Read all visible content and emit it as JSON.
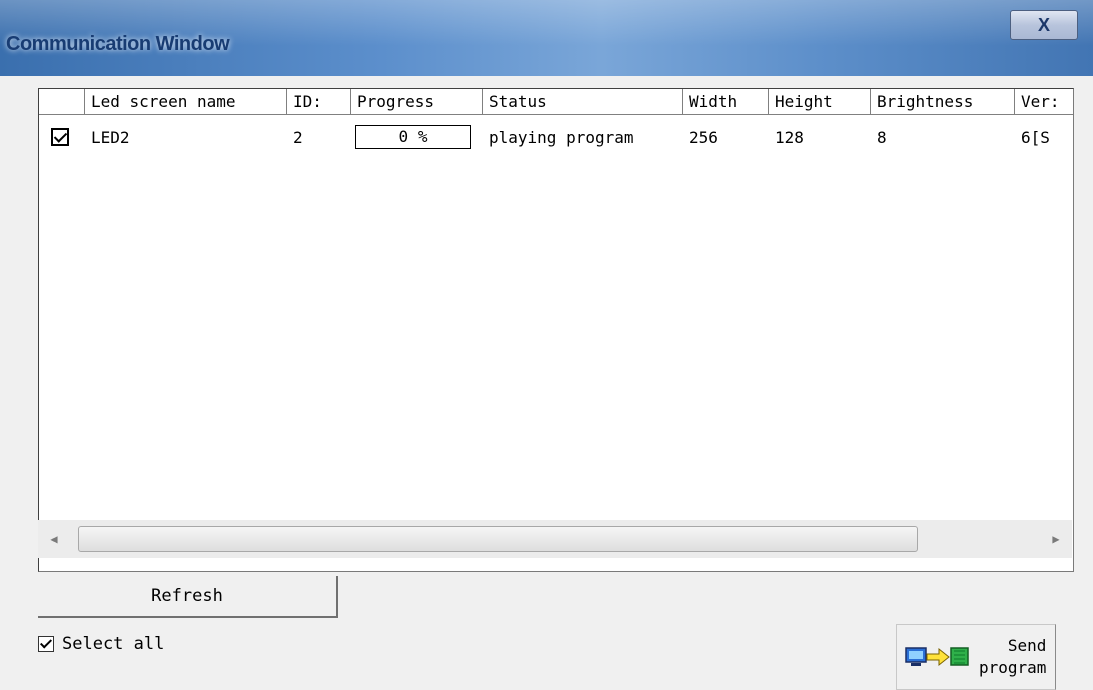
{
  "window": {
    "title": "Communication Window",
    "close_label": "X"
  },
  "table": {
    "columns": [
      "Led screen name",
      "ID:",
      "Progress",
      "Status",
      "Width",
      "Height",
      "Brightness",
      "Ver:"
    ],
    "rows": [
      {
        "checked": true,
        "name": "LED2",
        "id": "2",
        "progress": "0 %",
        "status": "playing program",
        "width": "256",
        "height": "128",
        "brightness": "8",
        "version": "6[S"
      }
    ]
  },
  "scrollbar": {
    "left_arrow": "◀",
    "right_arrow": "▶"
  },
  "buttons": {
    "refresh": "Refresh",
    "send_line1": "Send",
    "send_line2": "program"
  },
  "select_all": {
    "label": "Select all",
    "checked": true
  },
  "colors": {
    "title_bar": "#5c8fcc",
    "title_text": "#183c73",
    "window_bg": "#f0f0f0"
  }
}
